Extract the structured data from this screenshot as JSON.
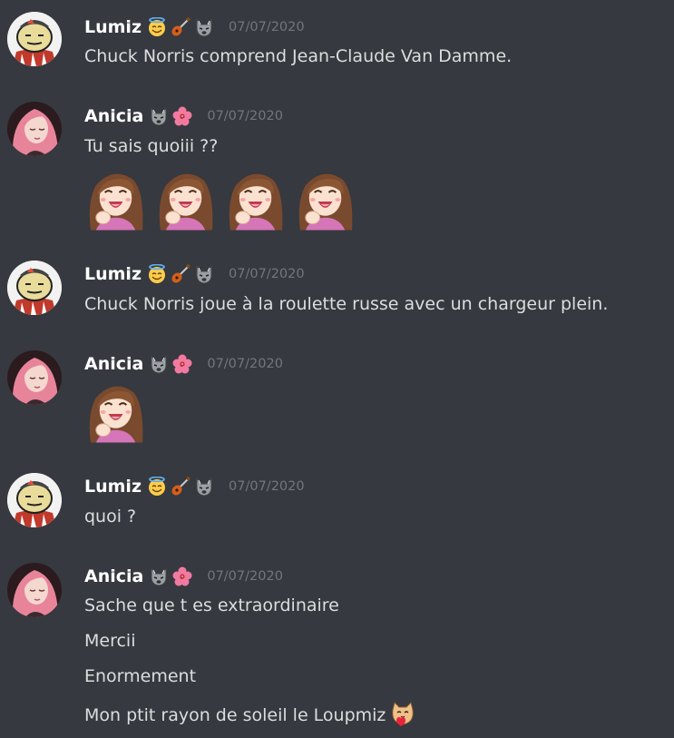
{
  "users": {
    "lumiz": {
      "name": "Lumiz",
      "badges": [
        "halo-smile-icon",
        "guitar-icon",
        "wolf-icon"
      ]
    },
    "anicia": {
      "name": "Anicia",
      "badges": [
        "wolf-icon",
        "hibiscus-icon"
      ]
    }
  },
  "messages": [
    {
      "author": "Lumiz",
      "timestamp": "07/07/2020",
      "lines": [
        "Chuck Norris comprend Jean-Claude Van Damme."
      ]
    },
    {
      "author": "Anicia",
      "timestamp": "07/07/2020",
      "lines": [
        "Tu sais quoiii ??"
      ],
      "emotes": [
        "laughing-girl-emote",
        "laughing-girl-emote",
        "laughing-girl-emote",
        "laughing-girl-emote"
      ]
    },
    {
      "author": "Lumiz",
      "timestamp": "07/07/2020",
      "lines": [
        "Chuck Norris joue à la roulette russe avec un chargeur plein."
      ]
    },
    {
      "author": "Anicia",
      "timestamp": "07/07/2020",
      "lines": [],
      "emotes": [
        "laughing-girl-emote"
      ]
    },
    {
      "author": "Lumiz",
      "timestamp": "07/07/2020",
      "lines": [
        "quoi ?"
      ]
    },
    {
      "author": "Anicia",
      "timestamp": "07/07/2020",
      "lines": [
        "Sache que t es extraordinaire",
        "Mercii",
        "Enormement",
        "Mon ptit rayon de soleil le Loupmiz"
      ],
      "inline_emote": "cat-heart-emote"
    }
  ],
  "colors": {
    "background": "#36393f",
    "username": "#ffffff",
    "message_text": "#dcddde",
    "timestamp": "#72767d"
  }
}
